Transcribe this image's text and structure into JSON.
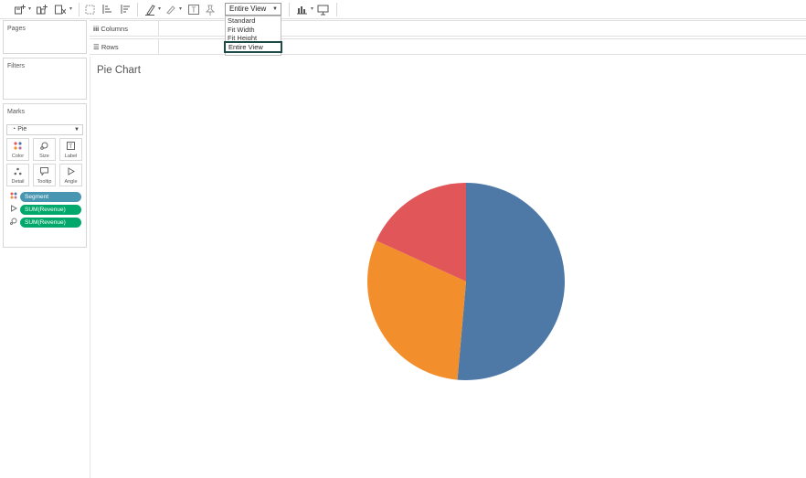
{
  "toolbar": {
    "view_select": {
      "value": "Entire View"
    },
    "view_options": [
      "Standard",
      "Fit Width",
      "Fit Height",
      "Entire View"
    ],
    "icons": [
      "new-worksheet-icon",
      "new-dashboard-icon",
      "clear-sheet-icon",
      "group-icon",
      "sort-ascending-icon",
      "sort-descending-icon",
      "highlight-icon",
      "annotate-icon",
      "label-icon",
      "pin-icon",
      "show-me-icon",
      "presentation-icon"
    ]
  },
  "panels": {
    "pages": "Pages",
    "filters": "Filters",
    "marks": "Marks"
  },
  "marks": {
    "type": "Pie",
    "buttons": [
      {
        "label": "Color",
        "icon": "color-icon"
      },
      {
        "label": "Size",
        "icon": "size-icon"
      },
      {
        "label": "Label",
        "icon": "label-icon"
      },
      {
        "label": "Detail",
        "icon": "detail-icon"
      },
      {
        "label": "Tooltip",
        "icon": "tooltip-icon"
      },
      {
        "label": "Angle",
        "icon": "angle-icon"
      }
    ],
    "pills": [
      {
        "label": "Segment",
        "color": "#4996b2",
        "icon": "color-dots-icon"
      },
      {
        "label": "SUM(Revenue)",
        "color": "#00a86b",
        "icon": "angle-icon"
      },
      {
        "label": "SUM(Revenue)",
        "color": "#00a86b",
        "icon": "size-icon"
      }
    ]
  },
  "shelves": {
    "columns": "Columns",
    "rows": "Rows"
  },
  "canvas": {
    "title": "Pie Chart"
  },
  "chart_data": {
    "type": "pie",
    "title": "Pie Chart",
    "slices": [
      {
        "value": 51.4,
        "color": "#4e79a7"
      },
      {
        "value": 30.4,
        "color": "#f28e2b"
      },
      {
        "value": 18.2,
        "color": "#e15759"
      }
    ]
  }
}
